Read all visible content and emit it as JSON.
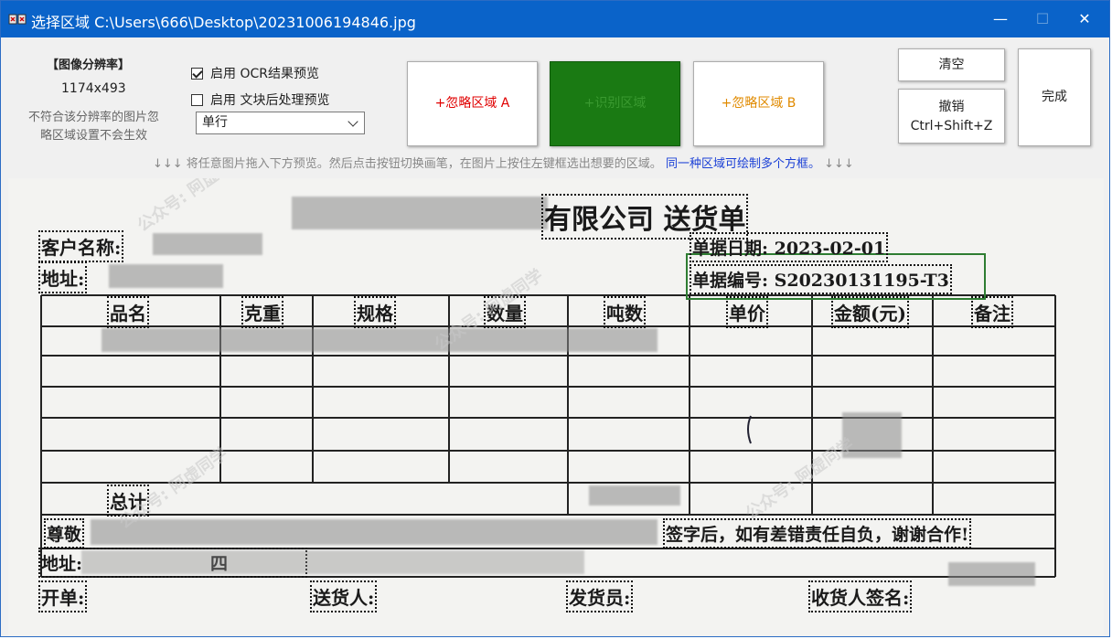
{
  "window": {
    "title": "选择区域 C:\\Users\\666\\Desktop\\20231006194846.jpg",
    "minimize_glyph": "—",
    "maximize_glyph": "☐",
    "close_glyph": "✕"
  },
  "resolution": {
    "title": "【图像分辨率】",
    "value": "1174x493",
    "note": "不符合该分辨率的图片忽略区域设置不会生效"
  },
  "options": {
    "ocr_preview_label": "启用 OCR结果预览",
    "ocr_preview_checked": true,
    "block_preview_label": "启用 文块后处理预览",
    "block_preview_checked": false,
    "layout_select_value": "单行"
  },
  "buttons": {
    "ignore_a": "+忽略区域 A",
    "recognize": "+识别区域",
    "ignore_b": "+忽略区域 B",
    "clear": "清空",
    "undo_line1": "撤销",
    "undo_line2": "Ctrl+Shift+Z",
    "done": "完成"
  },
  "hint": {
    "main": "↓↓↓ 将任意图片拖入下方预览。然后点击按钮切换画笔，在图片上按住左键框选出想要的区域。",
    "blue": "同一种区域可绘制多个方框。",
    "tail": "↓↓↓"
  },
  "colors": {
    "titlebar": "#0a63c9",
    "ignore_a": "#e00000",
    "recognize_bg": "#1a7a13",
    "ignore_b": "#e08a00",
    "hint_blue": "#1a3fd6",
    "recognize_box": "#2e7d32"
  },
  "document": {
    "company_title": "有限公司 送货单",
    "customer_label": "客户名称:",
    "address_label": "地址:",
    "date_label": "单据日期: 2023-02-01",
    "number_label": "单据编号: S20230131195-T3",
    "columns": [
      "品名",
      "克重",
      "规格",
      "数量",
      "吨数",
      "单价",
      "金额(元)",
      "备注"
    ],
    "total_label": "总计",
    "note_prefix": "尊敬",
    "note_text": "签字后，如有差错责任自负，谢谢合作!",
    "footer_address": "地址:",
    "footer_address_fragment": "四",
    "issuer_label": "开单:",
    "deliverer_label": "送货人:",
    "shipper_label": "发货员:",
    "receiver_label": "收货人签名:"
  },
  "watermark": "公众号: 阿虚同学"
}
